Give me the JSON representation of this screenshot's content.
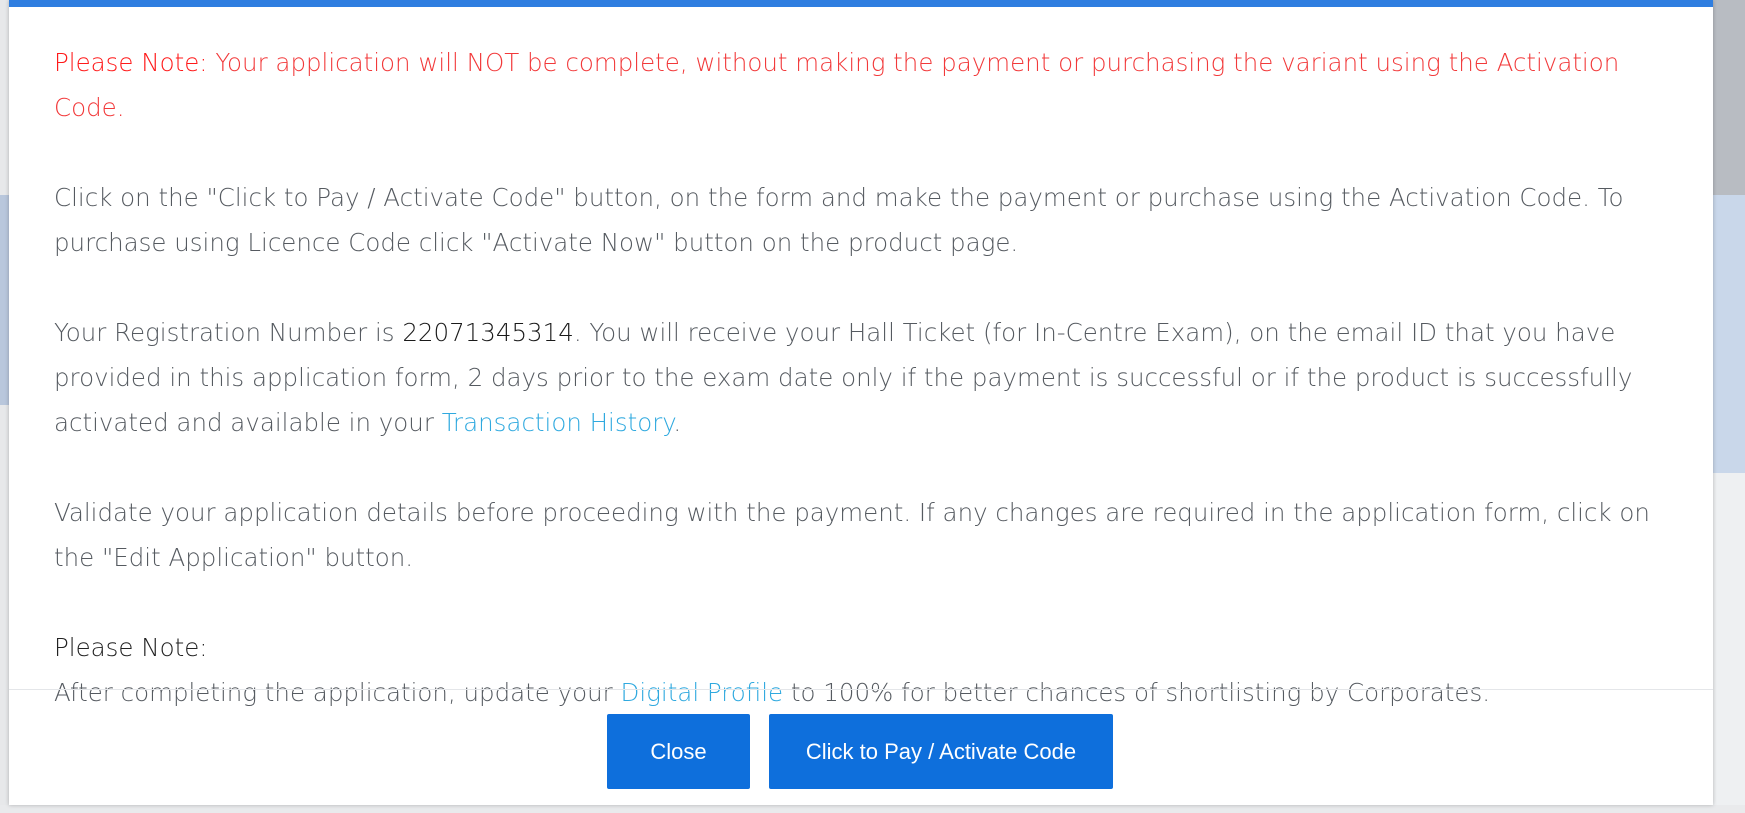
{
  "note_banner": {
    "label": "Please Note:",
    "text": "Your application will NOT be complete, without making the payment or purchasing the variant using the Activation Code."
  },
  "instructions": {
    "text": "Click on the \"Click to Pay / Activate Code\" button, on the form and make the payment or purchase using the Activation Code. To purchase using Licence Code click \"Activate Now\" button on the product page."
  },
  "registration": {
    "prefix": "Your Registration Number is ",
    "number": "22071345314",
    "middle": ". You will receive your Hall Ticket (for In-Centre Exam), on the email ID that you have provided in this application form, 2 days prior to the exam date only if the payment is successful or if the product is successfully activated and available in your ",
    "link_text": "Transaction History",
    "suffix": "."
  },
  "validate": {
    "text": "Validate your application details before proceeding with the payment. If any changes are required in the application form, click on the \"Edit Application\" button."
  },
  "profile_note": {
    "heading": "Please Note:",
    "prefix": "After completing the application, update your ",
    "link_text": "Digital Profile",
    "suffix": " to 100% for better chances of shortlisting by Corporates."
  },
  "footer": {
    "close_label": "Close",
    "pay_label": "Click to Pay / Activate Code"
  },
  "colors": {
    "accent": "#0e6fdc",
    "warning": "#f2393a",
    "link": "#2fa9df"
  }
}
